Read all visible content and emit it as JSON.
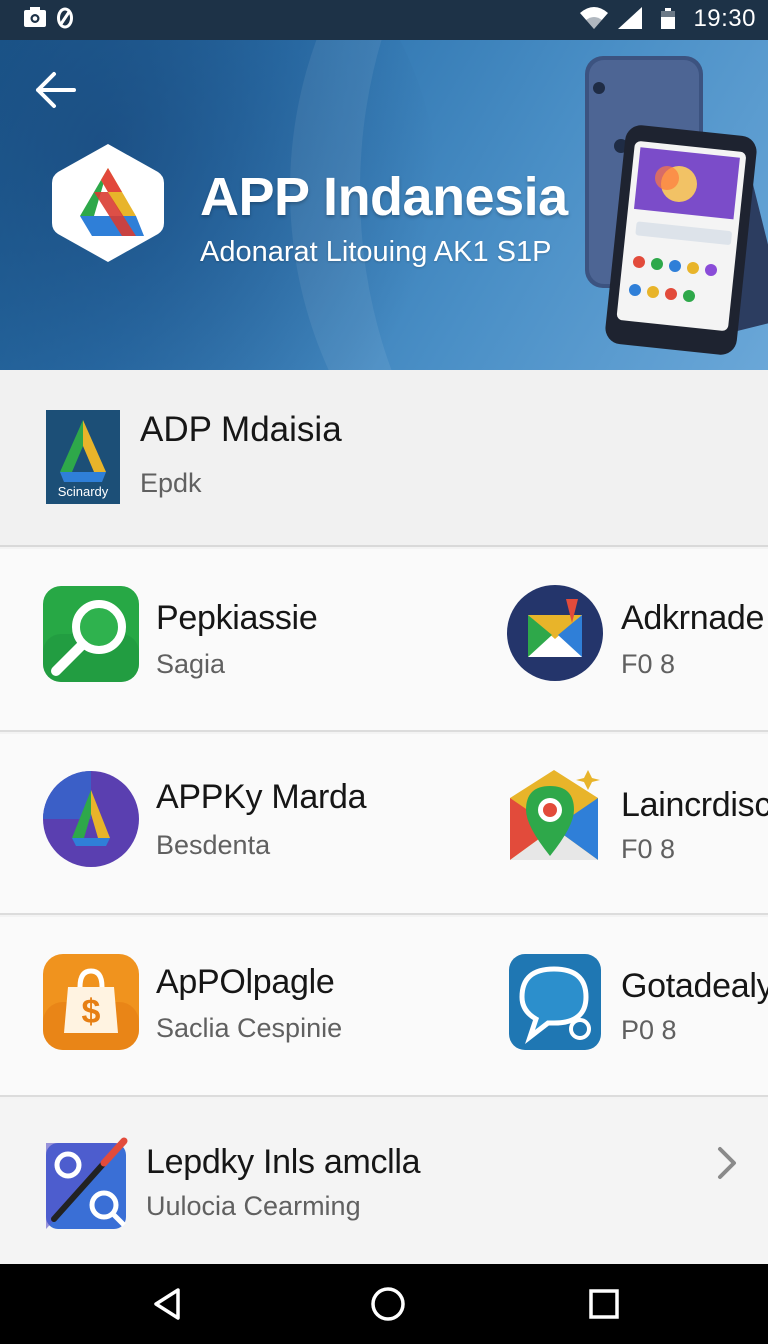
{
  "status_bar": {
    "time": "19:30",
    "icons": [
      "screenshot-icon",
      "sync-icon",
      "wifi-icon",
      "signal-icon",
      "battery-icon"
    ]
  },
  "hero": {
    "title": "APP Indanesia",
    "subtitle": "Adonarat Litouing AK1 S1P",
    "back_icon": "arrow-left-icon"
  },
  "featured": {
    "name": "ADP Mdaisia",
    "subtitle": "Epdk",
    "icon_label": "Scinardy"
  },
  "rows": [
    {
      "left": {
        "name": "Pepkiassie",
        "subtitle": "Sagia",
        "icon": "search-app-icon"
      },
      "right": {
        "name": "Adkrnade",
        "subtitle": "F0 8",
        "icon": "mail-app-icon"
      }
    },
    {
      "left": {
        "name": "APPKy Marda",
        "subtitle": "Besdenta",
        "icon": "drive-app-icon"
      },
      "right": {
        "name": "Laincrdisc",
        "subtitle": "F0 8",
        "icon": "map-pin-app-icon"
      }
    },
    {
      "left": {
        "name": "ApPOlpagle",
        "subtitle": "Saclia Cespinie",
        "icon": "shopping-bag-app-icon"
      },
      "right": {
        "name": "Gotadealy",
        "subtitle": "P0 8",
        "icon": "chat-app-icon"
      }
    }
  ],
  "last_item": {
    "name": "Lepdky Inls amclla",
    "subtitle": "Uulocia Cearming",
    "icon": "tools-app-icon"
  },
  "nav_bar": {
    "icons": [
      "back-triangle-icon",
      "home-circle-icon",
      "recents-square-icon"
    ]
  },
  "colors": {
    "status_bar": "#1d3247",
    "hero_blue": "#2c72ad",
    "nav_bar": "#000000"
  }
}
